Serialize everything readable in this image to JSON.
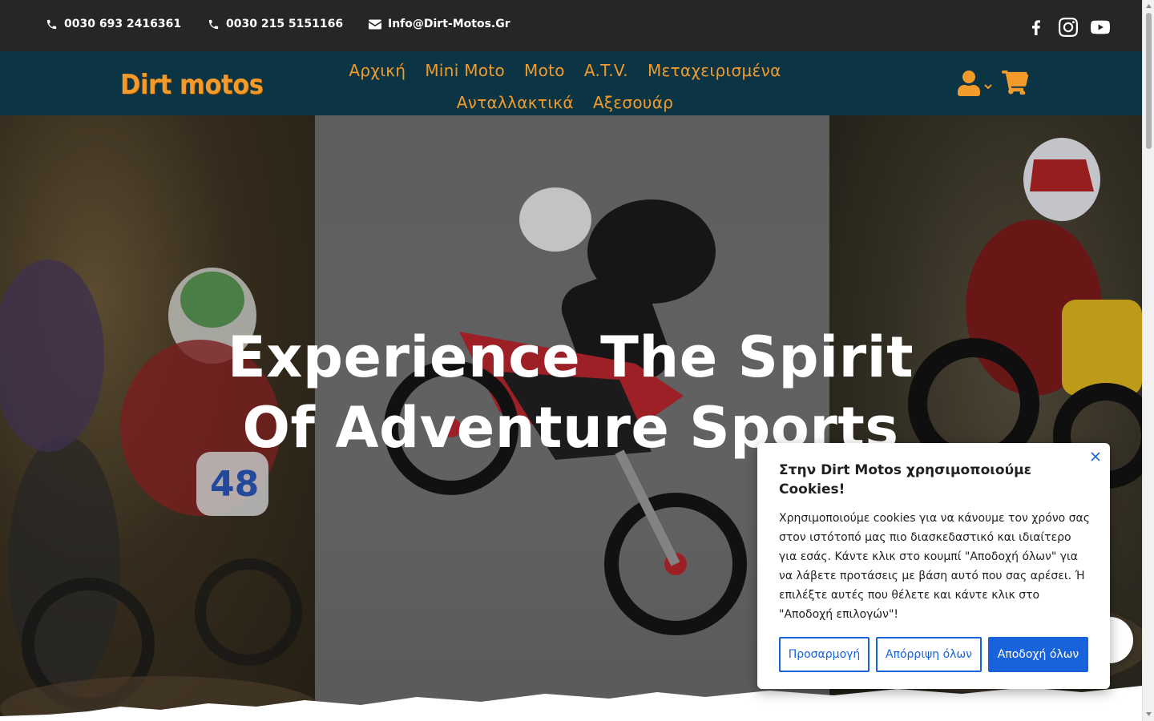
{
  "topbar": {
    "phone1": "0030 693 2416361",
    "phone2": "0030 215 5151166",
    "email": "Info@Dirt-Motos.Gr",
    "icons": [
      "phone-icon",
      "phone-icon",
      "envelope-icon",
      "facebook-icon",
      "instagram-icon",
      "youtube-icon"
    ]
  },
  "header": {
    "logo": "Dirt motos",
    "menu": [
      "Αρχική",
      "Mini Moto",
      "Moto",
      "A.T.V.",
      "Μεταχειρισμένα",
      "Ανταλλακτικά",
      "Αξεσουάρ"
    ],
    "icons": [
      "user-icon",
      "chevron-down-icon",
      "cart-icon"
    ]
  },
  "hero": {
    "title": "Experience The Spirit Of Adventure Sports"
  },
  "cookie_banner": {
    "title": "Στην Dirt Motos χρησιμοποιούμε Cookies!",
    "text": "Χρησιμοποιούμε cookies για να κάνουμε τον χρόνο σας στον ιστότοπό μας πιο διασκεδαστικό και ιδιαίτερο για εσάς. Κάντε κλικ στο κουμπί \"Αποδοχή όλων\" για να λάβετε προτάσεις με βάση αυτό που σας αρέσει. Ή επιλέξτε αυτές που θέλετε και κάντε κλικ στο \"Αποδοχή επιλογών\"!",
    "customize": "Προσαρμογή",
    "reject": "Απόρριψη όλων",
    "accept": "Αποδοχή όλων"
  },
  "colors": {
    "topbar": "#262626",
    "navbar": "#0b3444",
    "accent": "#f29b2a",
    "cookie_button": "#1863dc"
  }
}
